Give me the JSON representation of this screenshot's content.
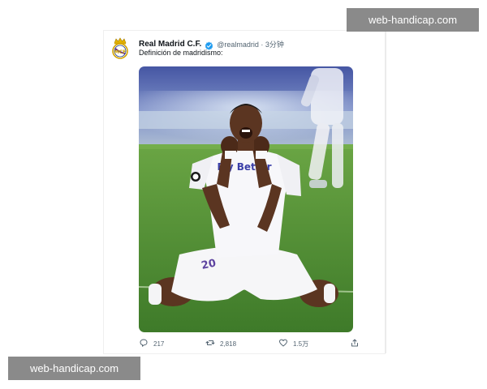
{
  "tweet": {
    "author_name": "Real Madrid C.F.",
    "handle_time": "@realmadrid · 3分钟",
    "text": "Definición de madridismo:",
    "media_icon": "photo-celebrating-player",
    "jersey_text": "Fly Better",
    "shorts_number": "20",
    "verified_icon": "verified-badge-icon",
    "avatar_icon": "real-madrid-crest-icon"
  },
  "actions": {
    "reply_count": "217",
    "retweet_count": "2,818",
    "like_count": "1.5万",
    "reply_icon": "reply-icon",
    "retweet_icon": "retweet-icon",
    "like_icon": "heart-icon",
    "share_icon": "share-icon"
  },
  "watermarks": {
    "top": "web-handicap.com",
    "bottom": "web-handicap.com"
  },
  "colors": {
    "verified_blue": "#1d9bf0",
    "grass_green": "#4f8f34",
    "watermark_gray": "#8a8a8a"
  }
}
